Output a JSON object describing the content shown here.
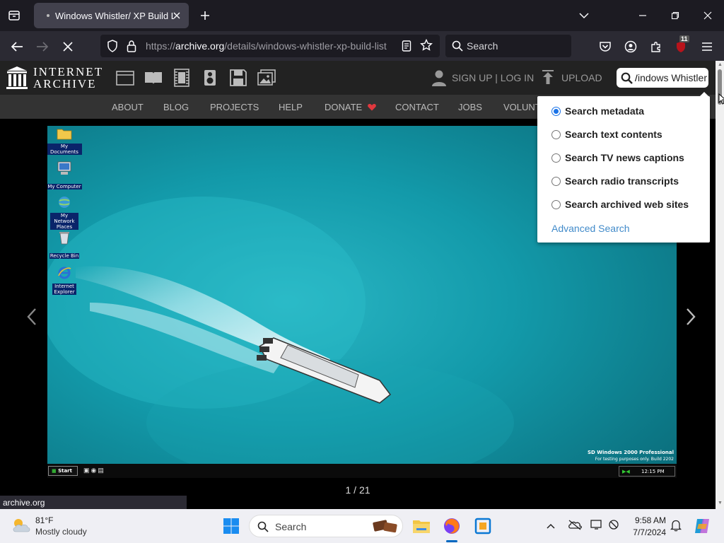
{
  "browser": {
    "tab_title": "Windows Whistler/ XP Build List",
    "url_prefix": "https://",
    "url_host": "archive.org",
    "url_path": "/details/windows-whistler-xp-build-list",
    "search_placeholder": "Search",
    "extension_badge": "11",
    "status_url": "archive.org"
  },
  "ia_header": {
    "logo_line1": "INTERNET",
    "logo_line2": "ARCHIVE",
    "signup_login": "SIGN UP | LOG IN",
    "upload": "UPLOAD",
    "search_value": "Windows Whistler"
  },
  "ia_nav": {
    "items": [
      "ABOUT",
      "BLOG",
      "PROJECTS",
      "HELP",
      "DONATE",
      "CONTACT",
      "JOBS",
      "VOLUNT"
    ]
  },
  "search_dropdown": {
    "options": [
      {
        "label": "Search metadata",
        "selected": true
      },
      {
        "label": "Search text contents",
        "selected": false
      },
      {
        "label": "Search TV news captions",
        "selected": false
      },
      {
        "label": "Search radio transcripts",
        "selected": false
      },
      {
        "label": "Search archived web sites",
        "selected": false
      }
    ],
    "advanced": "Advanced Search"
  },
  "viewer": {
    "counter": "1 / 21",
    "desktop_icons": [
      "My Documents",
      "My Computer",
      "My Network Places",
      "Recycle Bin",
      "Internet Explorer"
    ],
    "watermark_line1": "SD Windows 2000 Professional",
    "watermark_line2": "For testing purposes only. Build 2202",
    "start_label": "Start",
    "tray_time": "12:15 PM"
  },
  "taskbar": {
    "temperature": "81°F",
    "weather": "Mostly cloudy",
    "search_label": "Search",
    "time": "9:58 AM",
    "date": "7/7/2024"
  },
  "colors": {
    "ia_header_bg": "#222222",
    "link_blue": "#428bca",
    "radio_blue": "#1a73e8",
    "donate_heart": "#e0383e"
  }
}
